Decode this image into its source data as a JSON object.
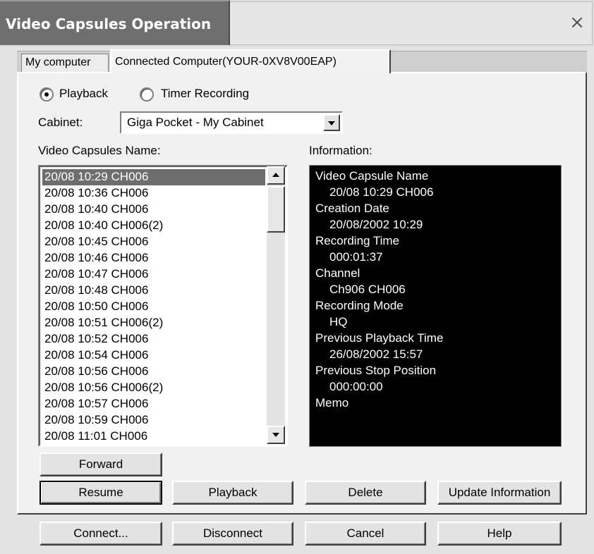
{
  "window": {
    "title": "Video Capsules Operation",
    "close_glyph": "×"
  },
  "tabs": [
    {
      "label": "My computer",
      "active": false
    },
    {
      "label": "Connected Computer(YOUR-0XV8V00EAP)",
      "active": true
    }
  ],
  "mode": {
    "playback_label": "Playback",
    "timer_label": "Timer Recording",
    "selected": "Playback"
  },
  "cabinet": {
    "label": "Cabinet:",
    "value": "Giga Pocket - My Cabinet"
  },
  "list": {
    "label": "Video Capsules Name:",
    "items": [
      "20/08 10:29 CH006",
      "20/08 10:36 CH006",
      "20/08 10:40 CH006",
      "20/08 10:40 CH006(2)",
      "20/08 10:45 CH006",
      "20/08 10:46 CH006",
      "20/08 10:47 CH006",
      "20/08 10:48 CH006",
      "20/08 10:50 CH006",
      "20/08 10:51 CH006(2)",
      "20/08 10:52 CH006",
      "20/08 10:54 CH006",
      "20/08 10:56 CH006",
      "20/08 10:56 CH006(2)",
      "20/08 10:57 CH006",
      "20/08 10:59 CH006",
      "20/08 11:01 CH006"
    ],
    "selected_index": 0
  },
  "info": {
    "label": "Information:",
    "lines": [
      {
        "text": "Video Capsule Name",
        "value": false
      },
      {
        "text": "20/08 10:29 CH006",
        "value": true
      },
      {
        "text": "Creation Date",
        "value": false
      },
      {
        "text": "20/08/2002  10:29",
        "value": true
      },
      {
        "text": "Recording Time",
        "value": false
      },
      {
        "text": "000:01:37",
        "value": true
      },
      {
        "text": "Channel",
        "value": false
      },
      {
        "text": "Ch906 CH006",
        "value": true
      },
      {
        "text": "Recording Mode",
        "value": false
      },
      {
        "text": "HQ",
        "value": true
      },
      {
        "text": "Previous Playback Time",
        "value": false
      },
      {
        "text": "26/08/2002  15:57",
        "value": true
      },
      {
        "text": "Previous Stop Position",
        "value": false
      },
      {
        "text": "000:00:00",
        "value": true
      },
      {
        "text": "Memo",
        "value": false
      }
    ]
  },
  "buttons": {
    "forward": "Forward",
    "resume": "Resume",
    "playback": "Playback",
    "delete": "Delete",
    "update": "Update Information",
    "connect": "Connect...",
    "disconnect": "Disconnect",
    "cancel": "Cancel",
    "help": "Help"
  }
}
